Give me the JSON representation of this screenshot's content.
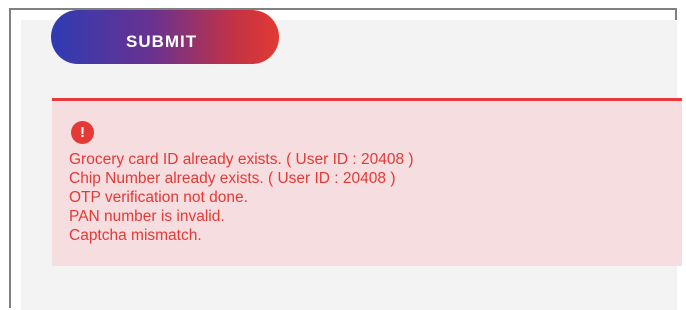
{
  "submit_button": {
    "label": "SUBMIT"
  },
  "error_alert": {
    "icon": "exclamation-circle-icon",
    "icon_glyph": "!",
    "color": "#e53935",
    "background": "#f5dde0",
    "messages": [
      "Grocery card ID already exists. ( User ID : 20408 )",
      "Chip Number already exists. ( User ID : 20408 )",
      "OTP verification not done.",
      "PAN number is invalid.",
      "Captcha mismatch."
    ]
  }
}
